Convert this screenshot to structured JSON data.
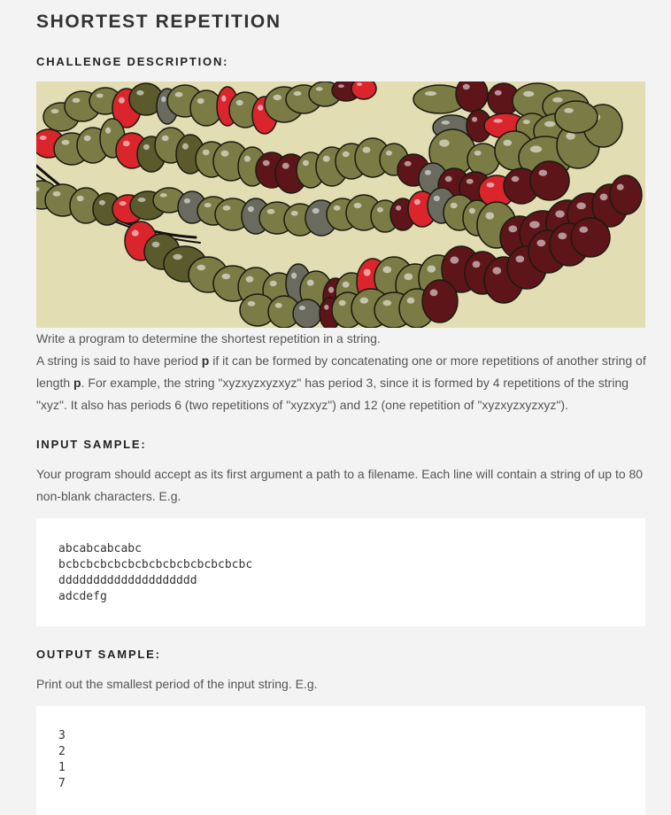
{
  "title": "SHORTEST REPETITION",
  "challenge": {
    "heading": "CHALLENGE DESCRIPTION:",
    "line1": "Write a program to determine the shortest repetition in a string.",
    "p1_a": "A string is said to have period ",
    "p1_var": "p",
    "p1_b": " if it can be formed by concatenating one or more repetitions of another string of length ",
    "p1_var2": "p",
    "p1_c": ". For example, the string \"xyzxyzxyzxyz\" has period 3, since it is formed by 4 repetitions of the string \"xyz\". It also has periods 6 (two repetitions of \"xyzxyz\") and 12 (one repetition of \"xyzxyzxyzxyz\")."
  },
  "input": {
    "heading": "INPUT SAMPLE:",
    "text": "Your program should accept as its first argument a path to a filename. Each line will contain a string of up to 80 non-blank characters. E.g.",
    "lines": [
      "abcabcabcabc",
      "bcbcbcbcbcbcbcbcbcbcbcbcbcbc",
      "dddddddddddddddddddd",
      "adcdefg"
    ]
  },
  "output": {
    "heading": "OUTPUT SAMPLE:",
    "text": "Print out the smallest period of the input string. E.g.",
    "lines": [
      "3",
      "2",
      "1",
      "7"
    ]
  },
  "colors": {
    "background": "#f3f3f3",
    "hero_bg": "#e2ddb3",
    "bead_olive": "#7b7c45",
    "bead_dark_olive": "#5a5a2c",
    "bead_red": "#d9252b",
    "bead_maroon": "#5e1519",
    "bead_gray": "#6a6a5e"
  }
}
